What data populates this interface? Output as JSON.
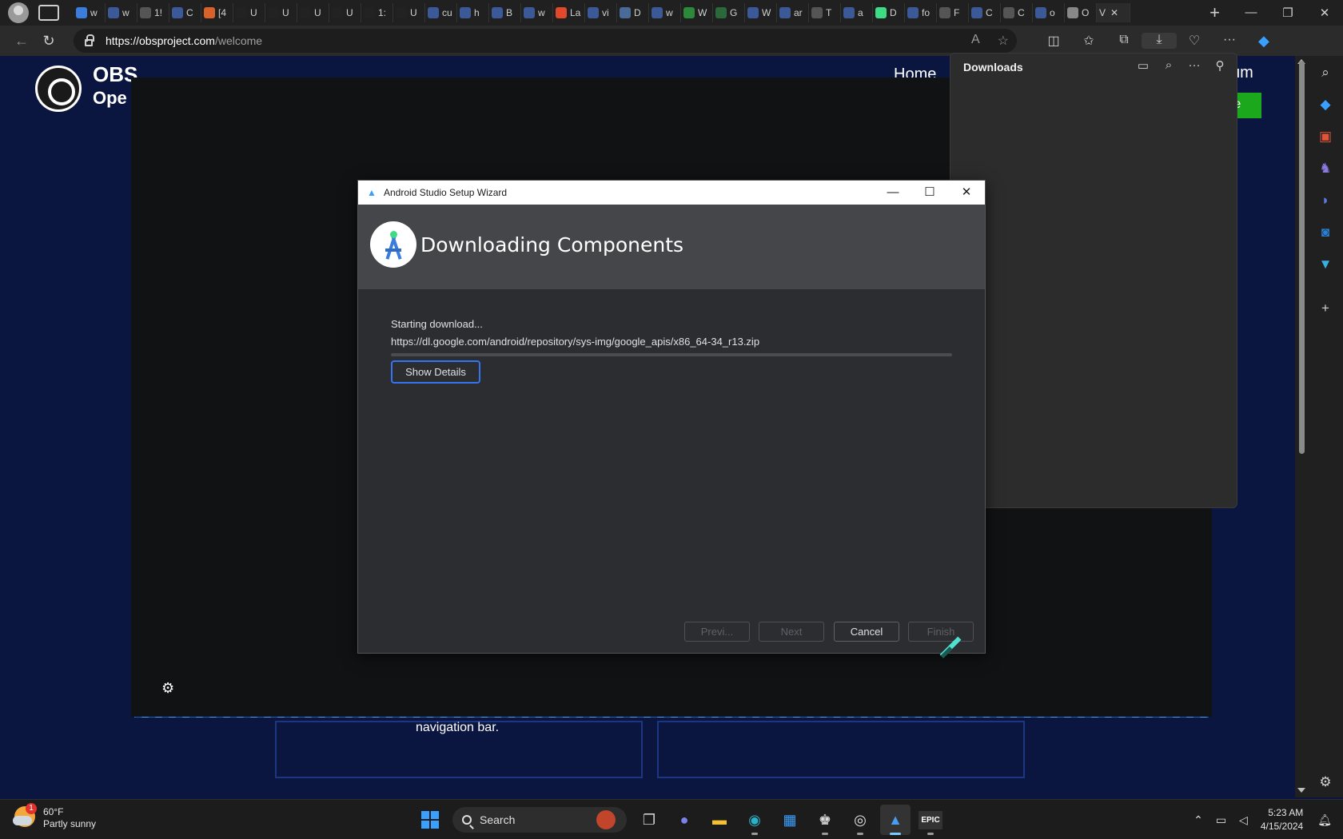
{
  "browser": {
    "tabs": [
      {
        "favicon_color": "#3b7ddd",
        "title": "w"
      },
      {
        "favicon_color": "#3b5998",
        "title": "w"
      },
      {
        "favicon_color": "#555555",
        "title": "1!"
      },
      {
        "favicon_color": "#3b5998",
        "title": "C"
      },
      {
        "favicon_color": "#d9612a",
        "title": "[4"
      },
      {
        "favicon_color": "#222222",
        "title": "U"
      },
      {
        "favicon_color": "#222222",
        "title": "U"
      },
      {
        "favicon_color": "#222222",
        "title": "U"
      },
      {
        "favicon_color": "#222222",
        "title": "U"
      },
      {
        "favicon_color": "#222222",
        "title": "1:"
      },
      {
        "favicon_color": "#222222",
        "title": "U"
      },
      {
        "favicon_color": "#3b5998",
        "title": "cu"
      },
      {
        "favicon_color": "#3b5998",
        "title": "h"
      },
      {
        "favicon_color": "#3b5998",
        "title": "B"
      },
      {
        "favicon_color": "#3b5998",
        "title": "w"
      },
      {
        "favicon_color": "#e04a2a",
        "title": "La"
      },
      {
        "favicon_color": "#3b5998",
        "title": "vi"
      },
      {
        "favicon_color": "#4a6a9a",
        "title": "D"
      },
      {
        "favicon_color": "#3b5998",
        "title": "w"
      },
      {
        "favicon_color": "#2a8a3a",
        "title": "W"
      },
      {
        "favicon_color": "#2a6a3a",
        "title": "G"
      },
      {
        "favicon_color": "#3b5998",
        "title": "W"
      },
      {
        "favicon_color": "#3b5998",
        "title": "ar"
      },
      {
        "favicon_color": "#555555",
        "title": "T"
      },
      {
        "favicon_color": "#3b5998",
        "title": "a"
      },
      {
        "favicon_color": "#3ddc84",
        "title": "D"
      },
      {
        "favicon_color": "#3b5998",
        "title": "fo"
      },
      {
        "favicon_color": "#555555",
        "title": "F"
      },
      {
        "favicon_color": "#3b5998",
        "title": "C"
      },
      {
        "favicon_color": "#555555",
        "title": "C"
      },
      {
        "favicon_color": "#3b5998",
        "title": "o"
      },
      {
        "favicon_color": "#888888",
        "title": "O"
      }
    ],
    "active_tab_title": "V",
    "address": {
      "host": "https://obsproject.com",
      "path": "/welcome"
    }
  },
  "downloads_panel": {
    "title": "Downloads"
  },
  "obs_page": {
    "brand_line1": "OBS",
    "brand_line2": "Ope",
    "nav_home": "Home",
    "nav_forum": "um",
    "contribute": "ute",
    "body_text": "navigation bar."
  },
  "wizard": {
    "window_title": "Android Studio Setup Wizard",
    "heading": "Downloading Components",
    "status": "Starting download...",
    "url": "https://dl.google.com/android/repository/sys-img/google_apis/x86_64-34_r13.zip",
    "progress": 0,
    "show_details": "Show Details",
    "buttons": {
      "previous": "Previ...",
      "next": "Next",
      "cancel": "Cancel",
      "finish": "Finish"
    }
  },
  "taskbar": {
    "weather": {
      "temp": "60°F",
      "condition": "Partly sunny",
      "badge": "1"
    },
    "search_label": "Search",
    "time": "5:23 AM",
    "date": "4/15/2024"
  },
  "colors": {
    "accent": "#3574f0",
    "page_bg": "#0b1640",
    "dialog_bg": "#2b2d30"
  }
}
